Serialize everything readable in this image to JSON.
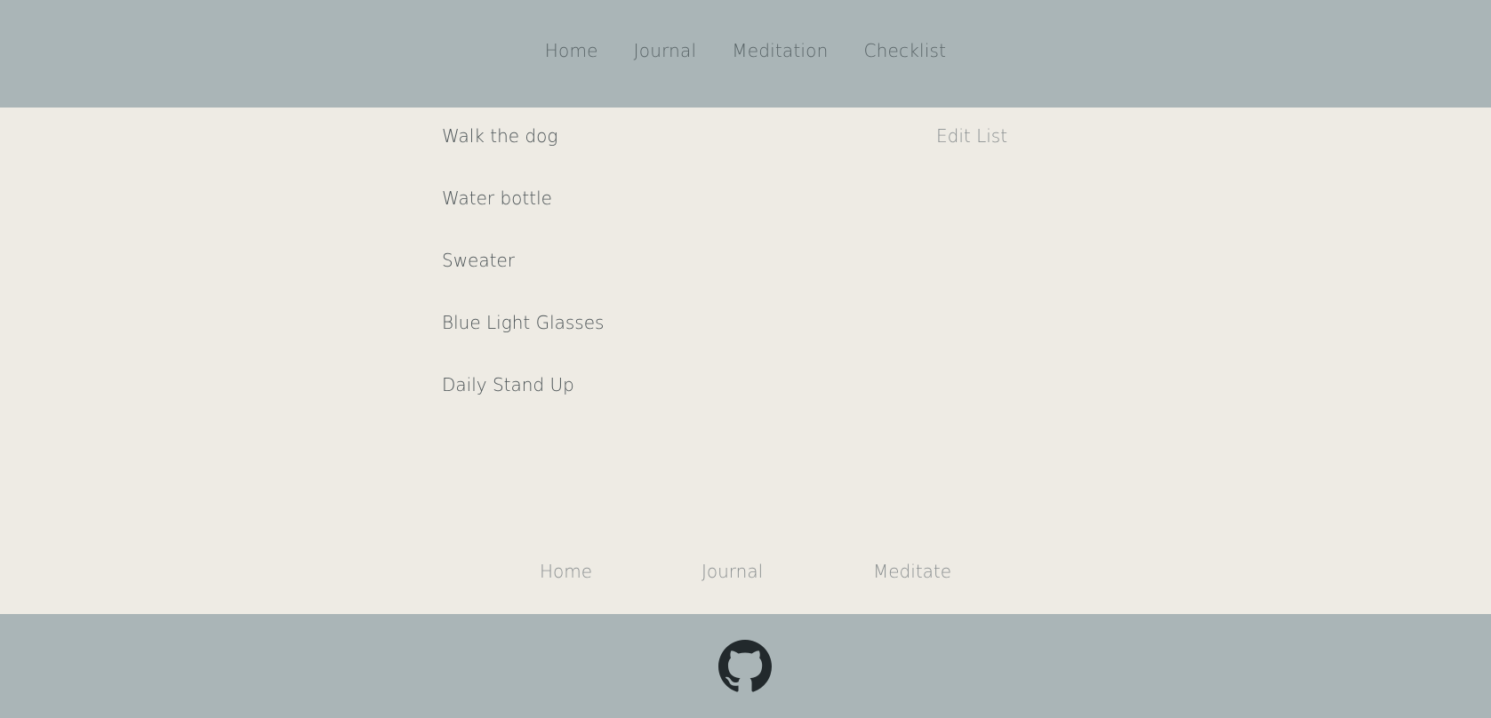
{
  "header": {
    "nav": [
      {
        "label": "Home"
      },
      {
        "label": "Journal"
      },
      {
        "label": "Meditation"
      },
      {
        "label": "Checklist"
      }
    ]
  },
  "checklist": {
    "items": [
      {
        "label": "Walk the dog"
      },
      {
        "label": "Water bottle"
      },
      {
        "label": "Sweater"
      },
      {
        "label": "Blue Light Glasses"
      },
      {
        "label": "Daily Stand Up"
      }
    ],
    "edit_label": "Edit List"
  },
  "bottom_nav": {
    "items": [
      {
        "label": "Home"
      },
      {
        "label": "Journal"
      },
      {
        "label": "Meditate"
      }
    ]
  },
  "footer": {
    "icon": "github-icon"
  },
  "colors": {
    "header_bg": "#aab5b7",
    "page_bg": "#eeebe4",
    "text": "#4a5255",
    "muted_text": "#8a8f90"
  }
}
